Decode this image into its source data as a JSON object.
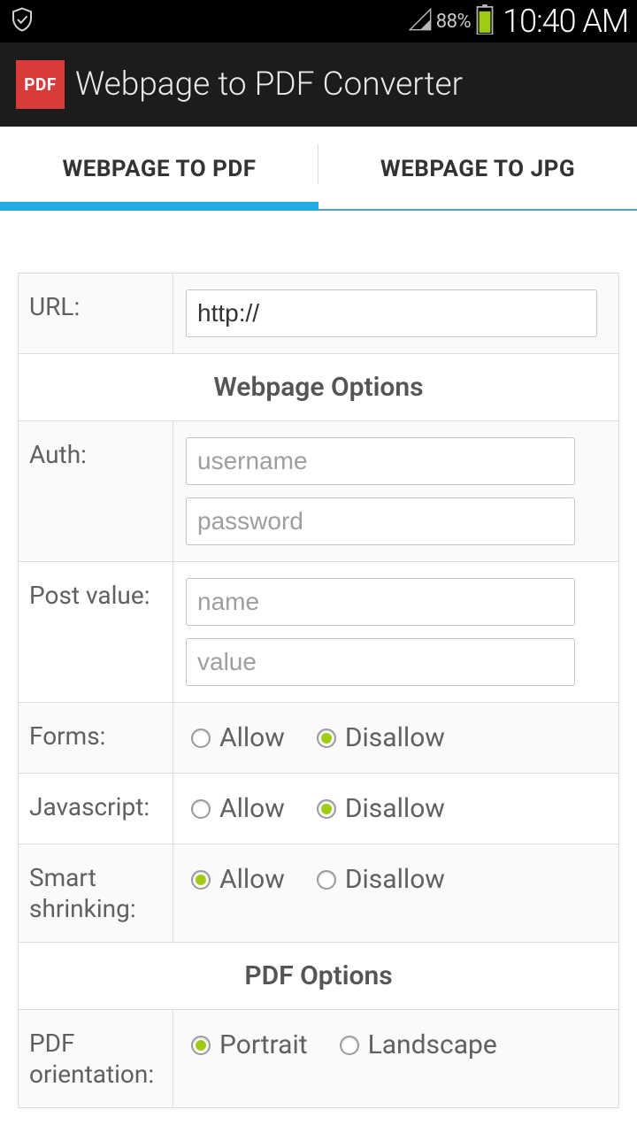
{
  "status": {
    "battery_pct": "88%",
    "time": "10:40 AM"
  },
  "title_bar": {
    "badge": "PDF",
    "title": "Webpage to PDF Converter"
  },
  "tabs": [
    {
      "label": "WEBPAGE TO PDF",
      "active": true
    },
    {
      "label": "WEBPAGE TO JPG",
      "active": false
    }
  ],
  "form": {
    "url_label": "URL:",
    "url_value": "http://",
    "section_webpage": "Webpage Options",
    "auth_label": "Auth:",
    "auth_user_ph": "username",
    "auth_pass_ph": "password",
    "post_label": "Post value:",
    "post_name_ph": "name",
    "post_value_ph": "value",
    "forms_label": "Forms:",
    "js_label": "Javascript:",
    "shrink_label": "Smart shrinking:",
    "section_pdf": "PDF Options",
    "orient_label": "PDF orientation:",
    "opt_allow": "Allow",
    "opt_disallow": "Disallow",
    "opt_portrait": "Portrait",
    "opt_landscape": "Landscape"
  }
}
